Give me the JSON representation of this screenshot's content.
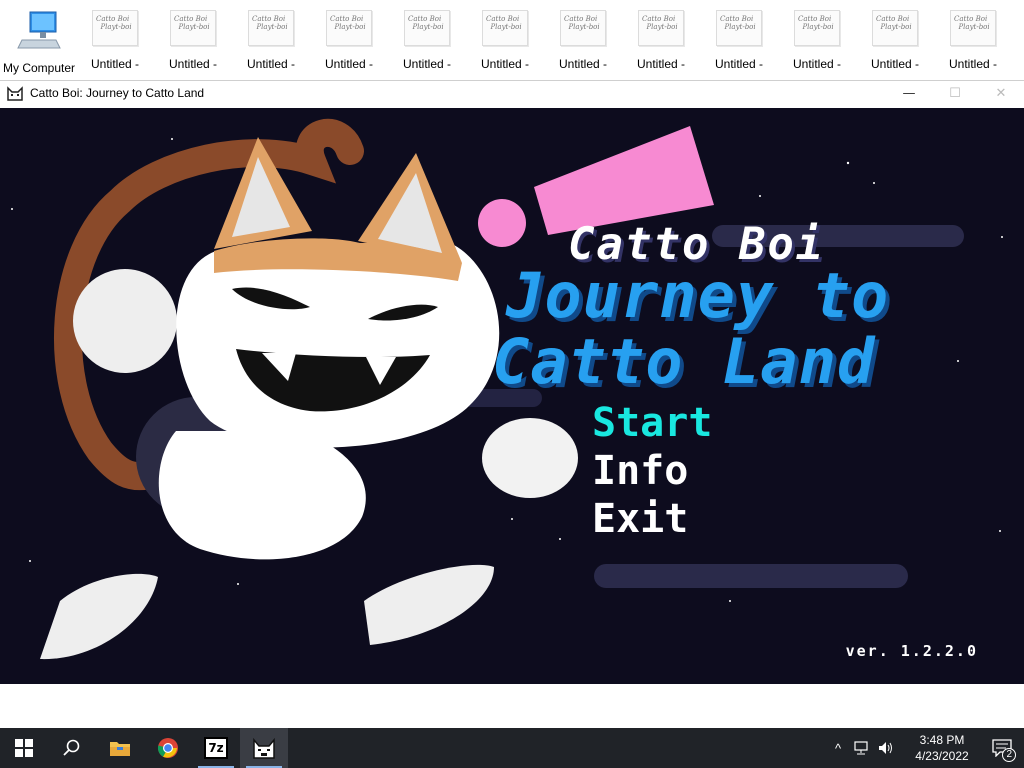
{
  "desktop": {
    "icons": [
      {
        "label": "My Computer"
      },
      {
        "label": "Untitled -"
      },
      {
        "label": "Untitled -"
      },
      {
        "label": "Untitled -"
      },
      {
        "label": "Untitled -"
      },
      {
        "label": "Untitled -"
      },
      {
        "label": "Untitled -"
      },
      {
        "label": "Untitled -"
      },
      {
        "label": "Untitled -"
      },
      {
        "label": "Untitled -"
      },
      {
        "label": "Untitled -"
      },
      {
        "label": "Untitled -"
      },
      {
        "label": "Untitled -"
      }
    ],
    "thumb_text": "Catto Boi\n  Playt-boi"
  },
  "window": {
    "title": "Catto Boi: Journey to Catto Land",
    "minimize": "—",
    "maximize": "☐",
    "close": "✕"
  },
  "game": {
    "title_small": "Catto Boi",
    "title_line1": "Journey to",
    "title_line2": "Catto Land",
    "menu": {
      "start": "Start",
      "info": "Info",
      "exit": "Exit"
    },
    "version": "ver. 1.2.2.0",
    "colors": {
      "background": "#0d0c1e",
      "title_blue": "#27a0f0",
      "start_cyan": "#19e8e0",
      "pink": "#f78ad2",
      "tail_brown": "#8a4a2a",
      "ear_orange": "#e0a266"
    }
  },
  "taskbar": {
    "items": [
      {
        "icon": "windows-start-icon"
      },
      {
        "icon": "search-icon"
      },
      {
        "icon": "file-explorer-icon"
      },
      {
        "icon": "chrome-icon"
      },
      {
        "icon": "7zip-icon",
        "text": "7z"
      },
      {
        "icon": "catto-boi-app-icon"
      }
    ],
    "tray": {
      "chevron": "^",
      "time": "3:48 PM",
      "date": "4/23/2022",
      "notifications": "2"
    }
  }
}
